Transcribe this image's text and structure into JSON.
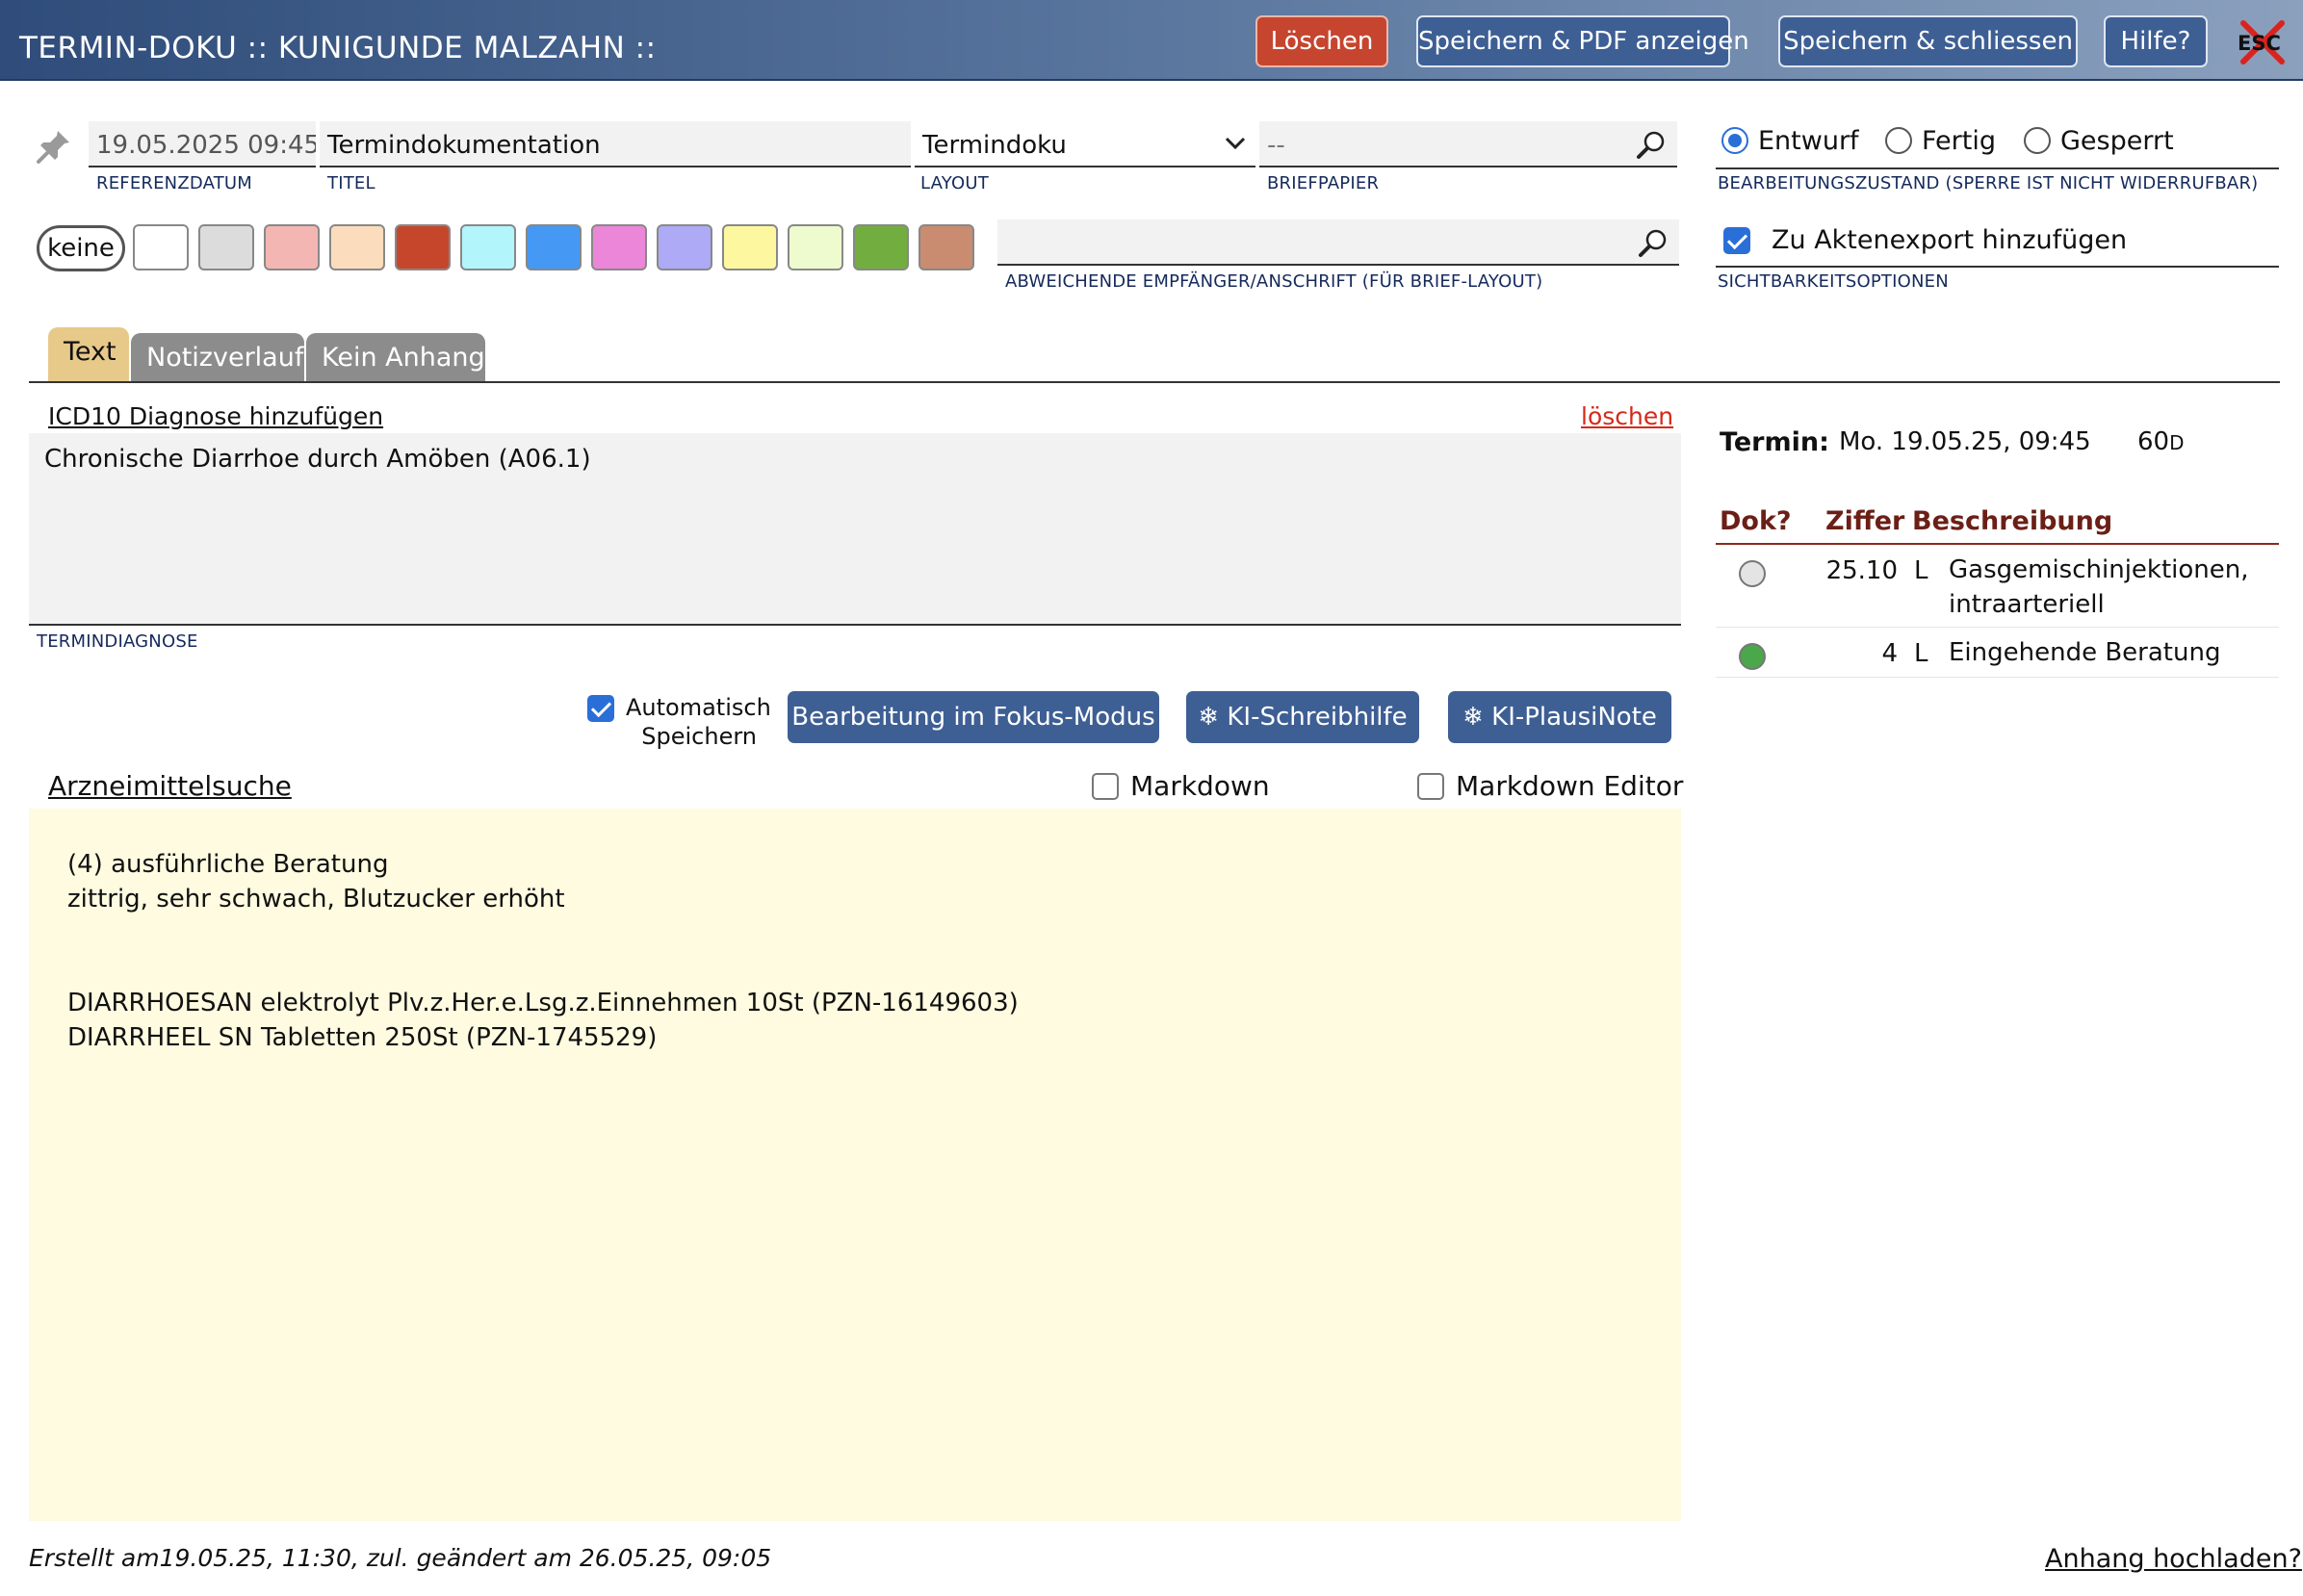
{
  "header": {
    "title": "TERMIN-DOKU :: KUNIGUNDE MALZAHN ::",
    "delete_label": "Löschen",
    "save_pdf_label": "Speichern & PDF anzeigen",
    "save_close_label": "Speichern & schliessen",
    "help_label": "Hilfe?",
    "esc_label": "ESC",
    "delete_color": "#c6452f",
    "button_color": "#3e5f94"
  },
  "fields": {
    "ref_date": {
      "value": "19.05.2025 09:45",
      "label": "REFERENZDATUM"
    },
    "title": {
      "value": "Termindokumentation",
      "label": "TITEL"
    },
    "layout": {
      "value": "Termindoku",
      "label": "LAYOUT"
    },
    "letterhead": {
      "value": "--",
      "label": "BRIEFPAPIER"
    },
    "recipient": {
      "value": "",
      "label": "ABWEICHENDE EMPFÄNGER/ANSCHRIFT (FÜR BRIEF-LAYOUT)"
    }
  },
  "status": {
    "options": [
      "Entwurf",
      "Fertig",
      "Gesperrt"
    ],
    "selected": "Entwurf",
    "label": "BEARBEITUNGSZUSTAND (SPERRE IST NICHT WIDERRUFBAR)"
  },
  "visibility": {
    "export_label": "Zu Aktenexport hinzufügen",
    "export_checked": true,
    "label": "SICHTBARKEITSOPTIONEN"
  },
  "colors": {
    "none_label": "keine",
    "swatches": [
      "#ffffff",
      "#dcdcdc",
      "#f4b6b3",
      "#fbdcbc",
      "#c6462b",
      "#b2f5fb",
      "#4598f3",
      "#ec86d9",
      "#aeaaf6",
      "#fdf8a0",
      "#eefbcf",
      "#72ae3f",
      "#c98c70"
    ]
  },
  "tabs": [
    "Text",
    "Notizverlauf",
    "Kein Anhang"
  ],
  "diagnosis": {
    "add_link": "ICD10 Diagnose hinzufügen",
    "delete_link": "löschen",
    "text": "Chronische Diarrhoe durch Amöben (A06.1)",
    "label": "TERMINDIAGNOSE"
  },
  "actions": {
    "autosave_label": "Automatisch Speichern",
    "autosave_checked": true,
    "focus_label": "Bearbeitung im Fokus-Modus",
    "ai_write_label": "KI-Schreibhilfe",
    "ai_plausi_label": "KI-PlausiNote",
    "drug_search": "Arzneimittelsuche",
    "markdown_label": "Markdown",
    "markdown_editor_label": "Markdown Editor"
  },
  "editor": {
    "text": "(4) ausführliche Beratung\nzittrig, sehr schwach, Blutzucker erhöht\n\n\nDIARRHOESAN elektrolyt Plv.z.Her.e.Lsg.z.Einnehmen 10St (PZN-16149603)\nDIARRHEEL SN Tabletten 250St (PZN-1745529)"
  },
  "footer": {
    "created": "Erstellt am19.05.25, 11:30, zul. geändert am 26.05.25, 09:05",
    "upload_link": "Anhang hochladen?"
  },
  "appointment": {
    "label": "Termin:",
    "date": "Mo. 19.05.25, 09:45",
    "duration_value": "60",
    "duration_unit": "D"
  },
  "billing": {
    "headers": [
      "Dok?",
      "Ziffer",
      "Beschreibung"
    ],
    "rows": [
      {
        "code": "25.10",
        "type": "L",
        "description": "Gasgemischinjektionen, intraarteriell",
        "documented": false,
        "dot_color": "#e4e4e4"
      },
      {
        "code": "4",
        "type": "L",
        "description": "Eingehende Beratung",
        "documented": true,
        "dot_color": "#4aa84a"
      }
    ]
  }
}
